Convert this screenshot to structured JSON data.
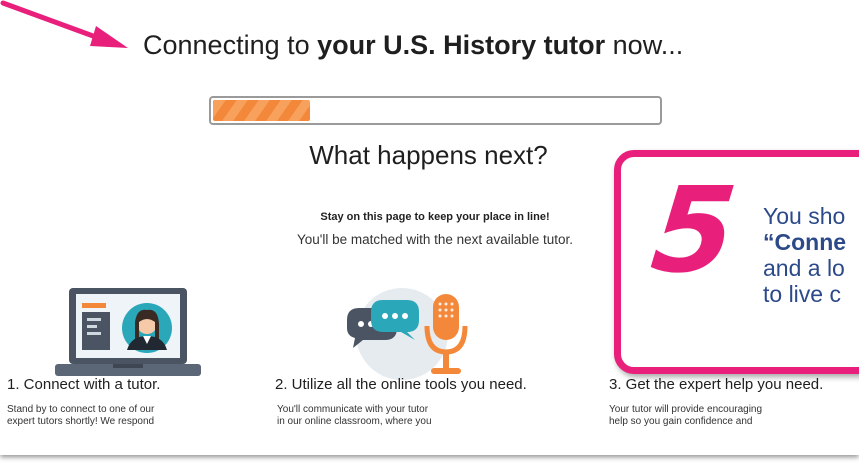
{
  "header": {
    "headline_prefix": "Connecting to ",
    "headline_subject": "your U.S. History tutor",
    "headline_suffix": " now..."
  },
  "progress": {
    "value_fraction": 0.22,
    "fill_color": "#f3883b"
  },
  "next": {
    "title": "What happens next?",
    "stay_note": "Stay on this page to keep your place in line!",
    "matched_note": "You'll be matched with the next available tutor."
  },
  "steps": [
    {
      "title": "1. Connect with a tutor.",
      "text_line1": "Stand by to connect to one of our",
      "text_line2": "expert tutors shortly! We respond"
    },
    {
      "title": "2. Utilize all the online tools you need.",
      "text_line1": "You'll communicate with your tutor",
      "text_line2": "in our online classroom, where you"
    },
    {
      "title": "3. Get the expert help you need.",
      "text_line1": "Your tutor will provide encouraging",
      "text_line2": "help so you gain confidence and"
    }
  ],
  "callout": {
    "number": "5",
    "line1": "You sho",
    "line2_bold": "“Conne",
    "line3": "and a lo",
    "line4": "to live c",
    "accent_color": "#e8207c",
    "text_color": "#2c4a8a"
  },
  "icons": {
    "arrow": "pointer-arrow-icon",
    "step1": "video-call-laptop-icon",
    "step2": "chat-microphone-icon"
  }
}
